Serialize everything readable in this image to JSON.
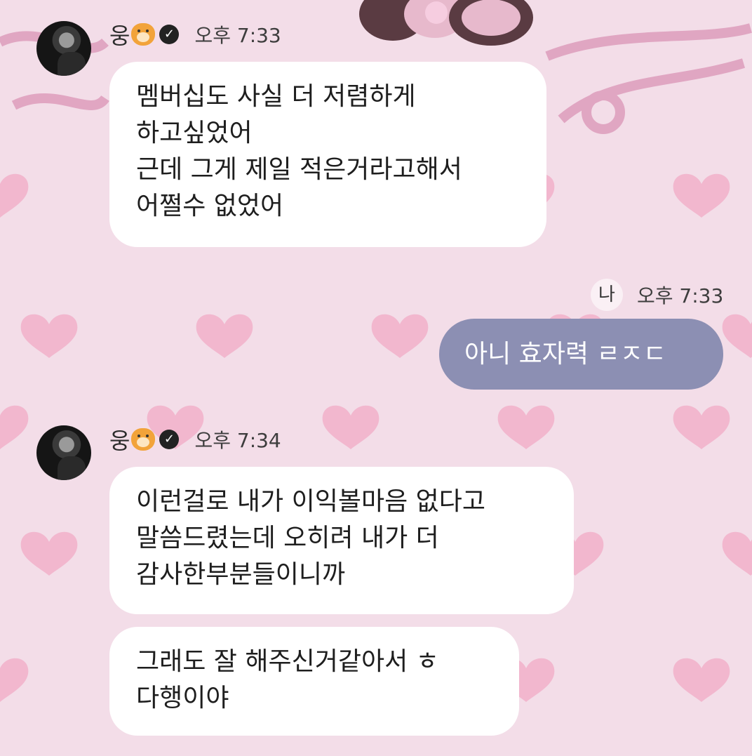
{
  "chat": {
    "partner": {
      "name": "웅"
    },
    "groups": [
      {
        "time": "오후 7:33",
        "messages": [
          "멤버십도 사실 더 저렴하게\n하고싶었어\n근데 그게 제일 적은거라고해서\n어쩔수 없었어"
        ]
      },
      {
        "time": "오후 7:34",
        "messages": [
          "이런걸로 내가 이익볼마음 없다고\n말씀드렸는데 오히려 내가 더\n감사한부분들이니까",
          "그래도 잘 해주신거같아서 ㅎ\n다행이야"
        ]
      }
    ],
    "me": {
      "label": "나",
      "time": "오후 7:33",
      "message": "아니 효자력 ㄹㅈㄷ"
    }
  },
  "colors": {
    "background": "#f3dde8",
    "heart": "#f2a9c6",
    "me_bubble": "#8c8fb3",
    "partner_bubble": "#ffffff"
  }
}
